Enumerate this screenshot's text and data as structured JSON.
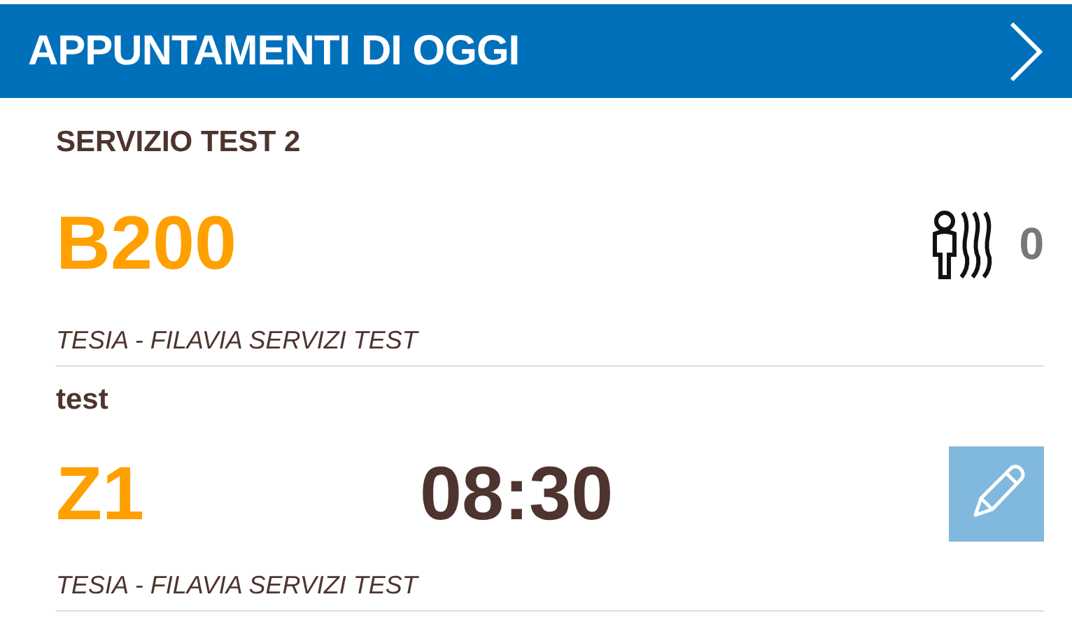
{
  "header": {
    "title": "APPUNTAMENTI DI OGGI"
  },
  "appointments": [
    {
      "kind": "queue",
      "service": "SERVIZIO TEST 2",
      "code": "B200",
      "count": "0",
      "location": "TESIA - FILAVIA SERVIZI TEST"
    },
    {
      "kind": "time",
      "service": "test",
      "code": "Z1",
      "time": "08:30",
      "location": "TESIA - FILAVIA SERVIZI TEST"
    }
  ]
}
